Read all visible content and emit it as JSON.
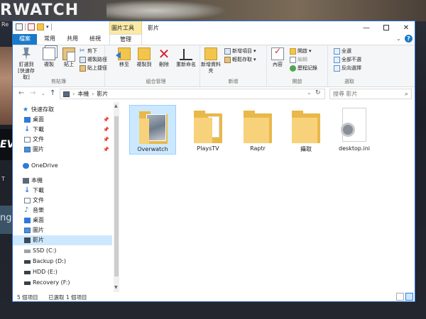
{
  "window": {
    "title": "影片",
    "context_tab_group": "圖片工具",
    "tabs": [
      "檔案",
      "常用",
      "共用",
      "檢視",
      "管理"
    ]
  },
  "ribbon": {
    "clipboard": {
      "label": "剪貼簿",
      "pin": "釘選到[快速存取]",
      "copy": "複製",
      "paste": "貼上",
      "cut": "剪下",
      "copy_path": "複製路徑",
      "paste_shortcut": "貼上捷徑"
    },
    "organize": {
      "label": "組合管理",
      "move_to": "移至",
      "copy_to": "複製到",
      "delete": "刪除",
      "rename": "重新命名"
    },
    "new": {
      "label": "新增",
      "new_folder": "新增資料夾",
      "new_item": "新增項目",
      "easy_access": "輕鬆存取"
    },
    "open": {
      "label": "開啟",
      "properties": "內容",
      "open": "開啟",
      "edit": "編輯",
      "history": "歷程記錄"
    },
    "select": {
      "label": "選取",
      "select_all": "全選",
      "select_none": "全部不選",
      "invert": "反向選擇"
    }
  },
  "address": {
    "path": [
      "本機",
      "影片"
    ],
    "search_placeholder": "搜尋 影片"
  },
  "nav_pane": {
    "quick_access": "快速存取",
    "qa_items": [
      "桌面",
      "下載",
      "文件",
      "圖片"
    ],
    "onedrive": "OneDrive",
    "this_pc": "本機",
    "pc_items": [
      "下載",
      "文件",
      "音樂",
      "桌面",
      "圖片",
      "影片"
    ],
    "drives": [
      "SSD (C:)",
      "Backup (D:)",
      "HDD (E:)",
      "Recovery (F:)"
    ]
  },
  "files": [
    {
      "name": "Overwatch",
      "type": "folder-image",
      "selected": true
    },
    {
      "name": "PlaysTV",
      "type": "folder-doc",
      "selected": false
    },
    {
      "name": "Raptr",
      "type": "folder",
      "selected": false
    },
    {
      "name": "攝取",
      "type": "folder",
      "selected": false
    },
    {
      "name": "desktop.ini",
      "type": "settings-file",
      "selected": false
    }
  ],
  "status": {
    "count": "5 個項目",
    "selected": "已選取 1 個項目"
  },
  "background": {
    "game_logo": "RWATCH",
    "left_text_1": "Re",
    "left_text_2": "EVER",
    "left_text_3": "ng",
    "left_text_4": "T"
  },
  "colors": {
    "accent": "#1979ca",
    "selection": "#cce8ff",
    "folder": "#f7d27a",
    "context_tab": "#fbe9a6"
  }
}
